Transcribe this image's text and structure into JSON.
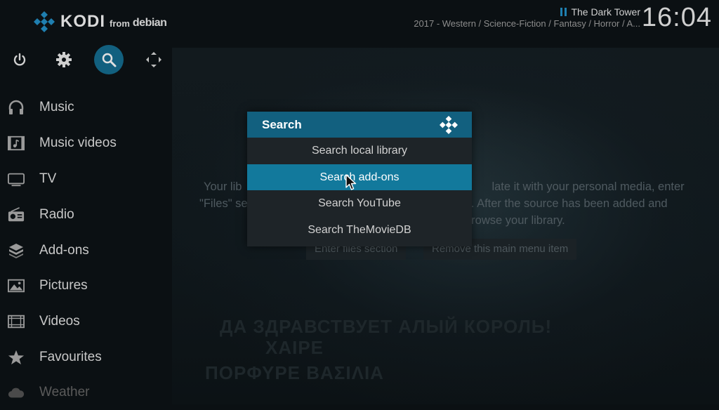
{
  "header": {
    "brand": "KODI",
    "from_label": "from",
    "distro": "debian",
    "now_playing_title": "The Dark Tower",
    "now_playing_subtitle": "2017 - Western / Science-Fiction / Fantasy / Horror / A...",
    "clock": "16:04"
  },
  "toolbar": {
    "buttons": [
      {
        "name": "power",
        "icon": "power-icon"
      },
      {
        "name": "settings",
        "icon": "gear-icon"
      },
      {
        "name": "search",
        "icon": "search-icon",
        "active": true
      },
      {
        "name": "fullscreen",
        "icon": "fullscreen-icon"
      }
    ]
  },
  "sidebar": {
    "items": [
      {
        "label": "Music",
        "icon": "headphones-icon"
      },
      {
        "label": "Music videos",
        "icon": "music-video-icon"
      },
      {
        "label": "TV",
        "icon": "tv-icon"
      },
      {
        "label": "Radio",
        "icon": "radio-icon"
      },
      {
        "label": "Add-ons",
        "icon": "addons-box-icon"
      },
      {
        "label": "Pictures",
        "icon": "pictures-icon"
      },
      {
        "label": "Videos",
        "icon": "film-icon"
      },
      {
        "label": "Favourites",
        "icon": "star-icon"
      },
      {
        "label": "Weather",
        "icon": "cloud-icon"
      }
    ]
  },
  "background": {
    "line1_left": "Your lib",
    "line1_right": "late it with your personal media, enter",
    "line2_left": "\"Files\" se",
    "line2_right": "it. After the source has been added and",
    "line3_right": "browse your library.",
    "button_enter_files": "Enter files section",
    "button_remove_item": "Remove this main menu item",
    "poster_line1": "ДА ЗДРАВСТВУЕТ АЛЫЙ КОРОЛЬ!",
    "poster_line2": "ΧΑΙΡΕ",
    "poster_line3": "ΠΟΡΦΥΡΕ ΒΑΣΙΛΙΑ"
  },
  "dialog": {
    "title": "Search",
    "items": [
      "Search local library",
      "Search add-ons",
      "Search YouTube",
      "Search TheMovieDB"
    ],
    "focused_index": 1
  },
  "colors": {
    "accent": "#12607f",
    "focus": "#12799c",
    "dialog_bg": "#1e2428"
  }
}
